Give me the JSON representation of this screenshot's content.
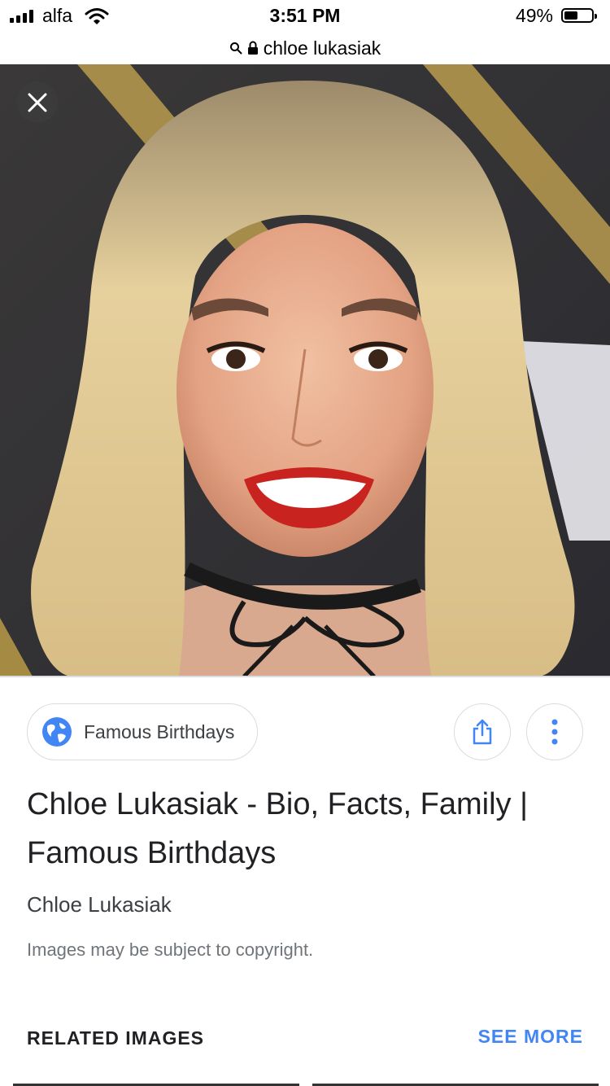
{
  "status_bar": {
    "carrier": "alfa",
    "time": "3:51 PM",
    "battery_percent": "49%",
    "battery_level": 0.49,
    "signal_bars": 4
  },
  "url_bar": {
    "search_icon": "search-icon",
    "lock_icon": "lock-icon",
    "query": "chloe lukasiak"
  },
  "image_viewer": {
    "close_icon": "close-icon"
  },
  "source": {
    "name": "Famous Birthdays",
    "icon": "globe-icon",
    "globe_color": "#4285f4"
  },
  "actions": {
    "share_icon": "share-icon",
    "more_icon": "more-vertical-icon",
    "accent": "#4285f4"
  },
  "result": {
    "title": "Chloe Lukasiak - Bio, Facts, Family | Famous Birthdays",
    "subtitle": "Chloe Lukasiak",
    "copyright_notice": "Images may be subject to copyright."
  },
  "related": {
    "heading": "RELATED IMAGES",
    "see_more": "SEE MORE"
  }
}
